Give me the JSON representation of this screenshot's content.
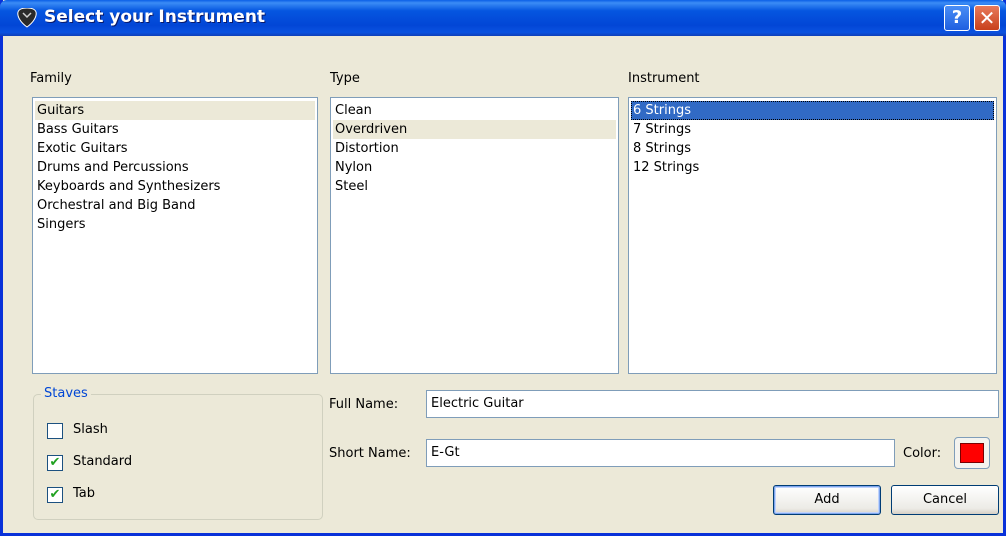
{
  "window": {
    "title": "Select your Instrument",
    "help_glyph": "?",
    "close_glyph": "✕"
  },
  "columns": {
    "family": {
      "label": "Family",
      "items": [
        "Guitars",
        "Bass Guitars",
        "Exotic Guitars",
        "Drums and Percussions",
        "Keyboards and Synthesizers",
        "Orchestral and Big Band",
        "Singers"
      ]
    },
    "type": {
      "label": "Type",
      "items": [
        "Clean",
        "Overdriven",
        "Distortion",
        "Nylon",
        "Steel"
      ]
    },
    "instrument": {
      "label": "Instrument",
      "items": [
        "6 Strings",
        "7 Strings",
        "8 Strings",
        "12 Strings"
      ]
    }
  },
  "staves": {
    "title": "Staves",
    "options": [
      {
        "label": "Slash",
        "checked": false
      },
      {
        "label": "Standard",
        "checked": true
      },
      {
        "label": "Tab",
        "checked": true
      }
    ]
  },
  "full_name": {
    "label": "Full Name:",
    "value": "Electric Guitar"
  },
  "short_name": {
    "label": "Short Name:",
    "value": "E-Gt"
  },
  "color": {
    "label": "Color:",
    "value": "#ff0000"
  },
  "buttons": {
    "add": "Add",
    "cancel": "Cancel"
  },
  "check_glyph": "✔"
}
